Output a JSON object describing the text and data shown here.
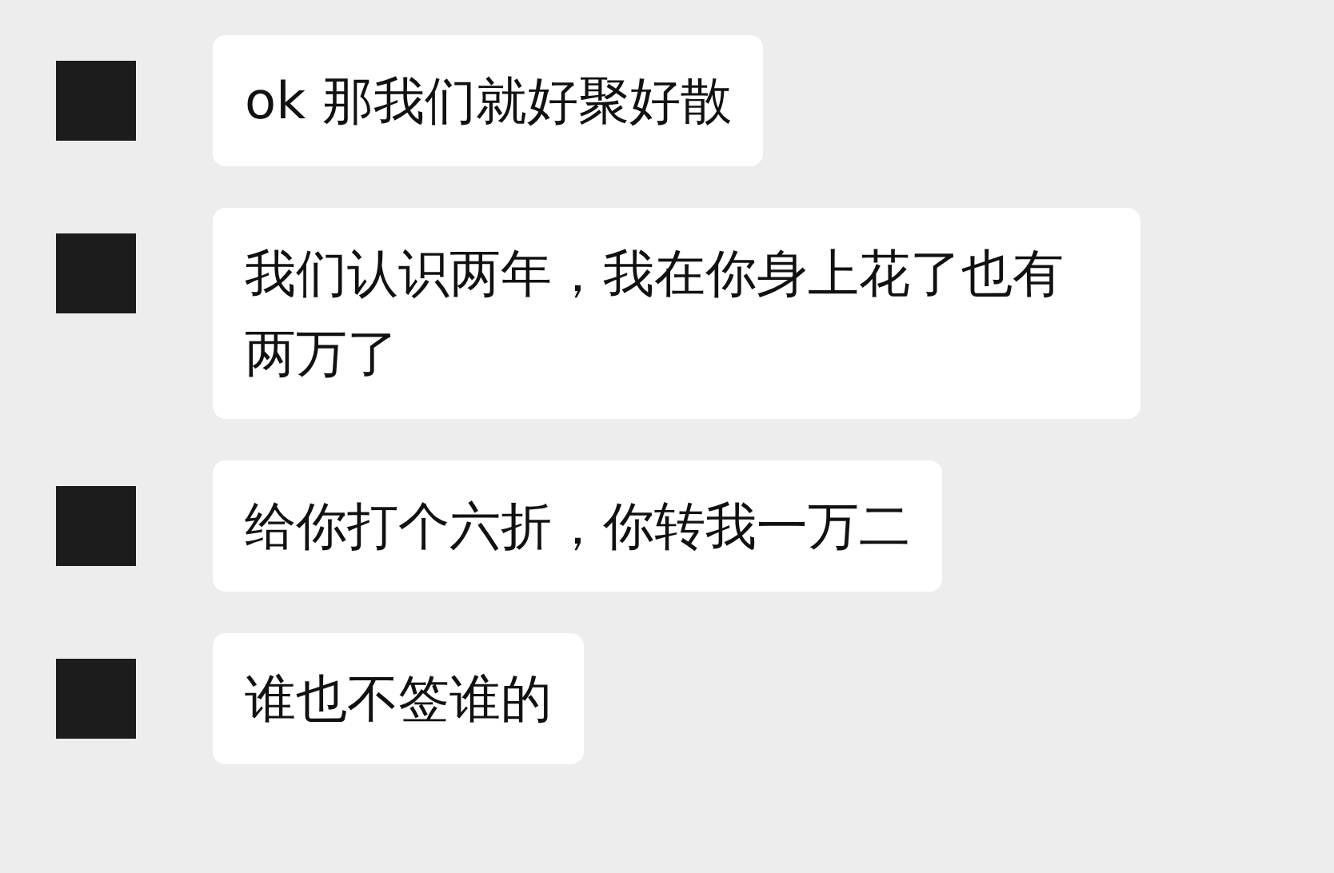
{
  "messages": [
    {
      "text": "ok 那我们就好聚好散"
    },
    {
      "text": "我们认识两年，我在你身上花了也有两万了"
    },
    {
      "text": "给你打个六折，你转我一万二"
    },
    {
      "text": "谁也不签谁的"
    }
  ]
}
